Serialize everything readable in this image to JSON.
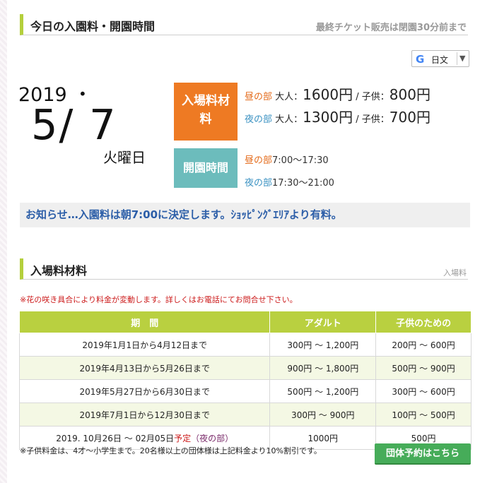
{
  "today": {
    "section_title": "今日の入園料・開園時間",
    "last_ticket_note": "最終チケット販売は閉園30分前まで",
    "year": "2019",
    "separator": "・",
    "date": "5/ 7",
    "weekday": "火曜日",
    "fee_box_label": "入場料材料",
    "hours_box_label": "開園時間",
    "fees": {
      "day_label": "昼の部",
      "night_label": "夜の部",
      "adult_label": "大人：",
      "child_label": "子供：",
      "slash": "/",
      "day_adult": "1600円",
      "day_child": "800円",
      "night_adult": "1300円",
      "night_child": "700円"
    },
    "hours": {
      "day": "7:00～17:30",
      "night": "17:30～21:00"
    }
  },
  "translate": {
    "language": "日文",
    "google_glyph": "G",
    "arrow": "▼"
  },
  "notice": "お知らせ…入園料は朝7:00に決定します。ｼｮｯﾋﾟﾝｸﾞｴﾘｱより有料。",
  "fees_section": {
    "title": "入場料材料",
    "subtitle": "入場料",
    "warning": "※花の咲き具合により料金が変動します。詳しくはお電話にてお問合せ下さい。",
    "headers": [
      "期　間",
      "アダルト",
      "子供のための"
    ],
    "rows": [
      {
        "period": "2019年1月1日から4月12日まで",
        "adult": "300円 ～ 1,200円",
        "child": "200円 ～ 600円"
      },
      {
        "period": "2019年4月13日から5月26日まで",
        "adult": "900円 ～ 1,800円",
        "child": "500円 ～ 900円"
      },
      {
        "period": "2019年5月27日から6月30日まで",
        "adult": "500円 ～ 1,200円",
        "child": "300円 ～ 600円"
      },
      {
        "period": "2019年7月1日から12月30日まで",
        "adult": "300円 ～ 900円",
        "child": "100円 ～ 500円"
      }
    ],
    "special_row": {
      "period": "2019. 10月26日 ～ 02月05日",
      "tag": "予定",
      "note": "（夜の部）",
      "adult": "1000円",
      "child": "500円"
    },
    "footnote": "※子供料金は、4才～小学生まで。20名様以上の団体様は上記料金より10%割引です。",
    "group_button": "団体予約はこちら"
  },
  "colors": {
    "accent_green": "#b4cf3c",
    "fee_orange": "#ee7a23",
    "hours_teal": "#6cbcbc",
    "notice_blue": "#2c5ea8",
    "button_green": "#46ac59"
  }
}
